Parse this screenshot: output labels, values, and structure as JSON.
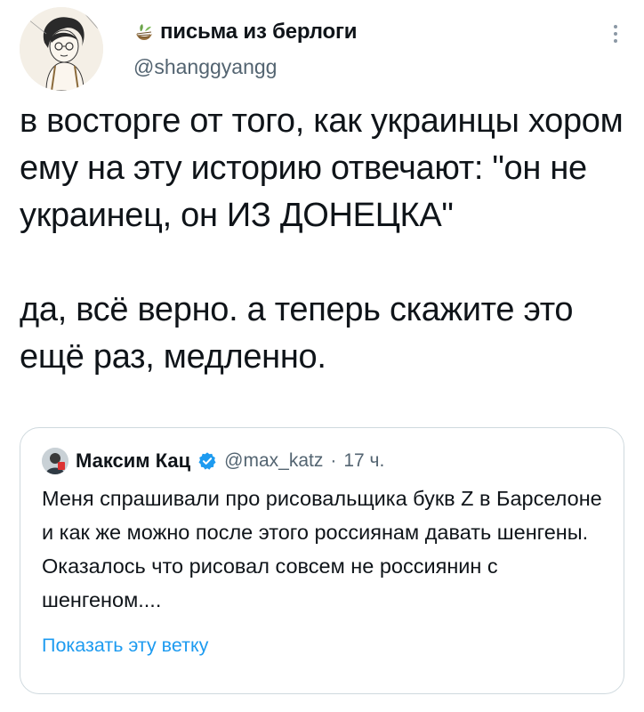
{
  "tweet": {
    "display_name": "письма из берлоги",
    "handle": "@shanggyangg",
    "text_lines": [
      "в восторге от того, как украинцы хором ему на эту историю отвечают: \"он не украинец, он ИЗ ДОНЕЦКА\"",
      "да, всё верно. а теперь скажите это ещё раз, медленно."
    ],
    "name_emoji_icon": "nest-icon",
    "more_icon": "more-vertical-icon"
  },
  "quote": {
    "display_name": "Максим Кац",
    "verified_icon": "verified-badge-icon",
    "handle": "@max_katz",
    "separator": "·",
    "time": "17 ч.",
    "text_lines": [
      "Меня спрашивали про рисовальщика букв Z в Барселоне и как же можно после этого россиянам давать шенгены.",
      "Оказалось что рисовал совсем не россиянин с шенгеном...."
    ],
    "show_thread": "Показать эту ветку"
  },
  "colors": {
    "text": "#0f1419",
    "secondary": "#536471",
    "link": "#1d9bf0",
    "border": "#cfd9de",
    "verified": "#1d9bf0"
  }
}
